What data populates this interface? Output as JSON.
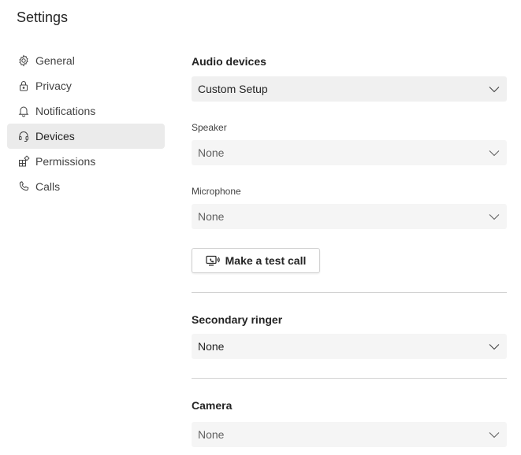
{
  "page": {
    "title": "Settings"
  },
  "sidebar": {
    "items": [
      {
        "label": "General",
        "icon": "gear-icon",
        "active": false
      },
      {
        "label": "Privacy",
        "icon": "lock-icon",
        "active": false
      },
      {
        "label": "Notifications",
        "icon": "bell-icon",
        "active": false
      },
      {
        "label": "Devices",
        "icon": "headset-icon",
        "active": true
      },
      {
        "label": "Permissions",
        "icon": "apps-icon",
        "active": false
      },
      {
        "label": "Calls",
        "icon": "phone-icon",
        "active": false
      }
    ]
  },
  "devices": {
    "audio": {
      "heading": "Audio devices",
      "setup_value": "Custom Setup",
      "speaker_label": "Speaker",
      "speaker_value": "None",
      "microphone_label": "Microphone",
      "microphone_value": "None",
      "test_call_button": "Make a test call"
    },
    "secondary_ringer": {
      "heading": "Secondary ringer",
      "value": "None"
    },
    "camera": {
      "heading": "Camera",
      "value": "None"
    }
  },
  "colors": {
    "active_nav_bg": "#ebebeb",
    "dropdown_bg": "#f5f5f5",
    "divider": "#d1d1d1"
  }
}
